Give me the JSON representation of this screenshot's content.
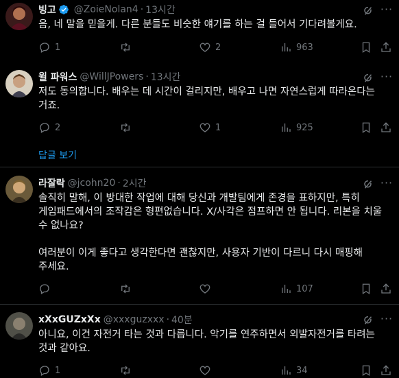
{
  "tweets": [
    {
      "name": "빙고",
      "handle": "@ZoieNolan4",
      "time": "13시간",
      "text": "음, 네 말을 믿을게. 다른 분들도 비슷한 얘기를 하는 걸 들어서 기다려볼게요.",
      "replies": "1",
      "retweets": "",
      "likes": "2",
      "views": "963",
      "verified": true
    },
    {
      "name": "윌 파워스",
      "handle": "@WillJPowers",
      "time": "13시간",
      "text": "저도 동의합니다. 배우는 데 시간이 걸리지만, 배우고 나면 자연스럽게 따라온다는 거죠.",
      "replies": "2",
      "retweets": "",
      "likes": "1",
      "views": "925",
      "verified": false
    },
    {
      "name": "라잘락",
      "handle": "@jcohn20",
      "time": "2시간",
      "text_p1": "솔직히 말해, 이 방대한 작업에 대해 당신과 개발팀에게 존경을 표하지만, 특히 게임패드에서의 조작감은 형편없습니다. X/사각은 점프하면 안 됩니다. 리본을 치울 수 없나요?",
      "text_p2": "여러분이 이게 좋다고 생각한다면 괜찮지만, 사용자 기반이 다르니 다시 매핑해 주세요.",
      "replies": "",
      "retweets": "",
      "likes": "",
      "views": "107",
      "verified": false
    },
    {
      "name": "xXxGUZxXx",
      "handle": "@xxxguzxxx",
      "time": "40분",
      "text": "아니요, 이건 자전거 타는 것과 다릅니다. 악기를 연주하면서 외발자전거를 타려는 것과 같아요.",
      "replies": "1",
      "retweets": "",
      "likes": "",
      "views": "34",
      "verified": false
    }
  ],
  "show_replies": "답글 보기",
  "sep": "·",
  "colors": {
    "bg": "#000000",
    "text": "#e7e9ea",
    "muted": "#71767b",
    "accent": "#1d9bf0",
    "border": "#2f3336"
  },
  "icons": [
    "reply-icon",
    "retweet-icon",
    "like-icon",
    "views-icon",
    "bookmark-icon",
    "share-icon",
    "grok-icon",
    "more-icon",
    "verified-icon"
  ]
}
